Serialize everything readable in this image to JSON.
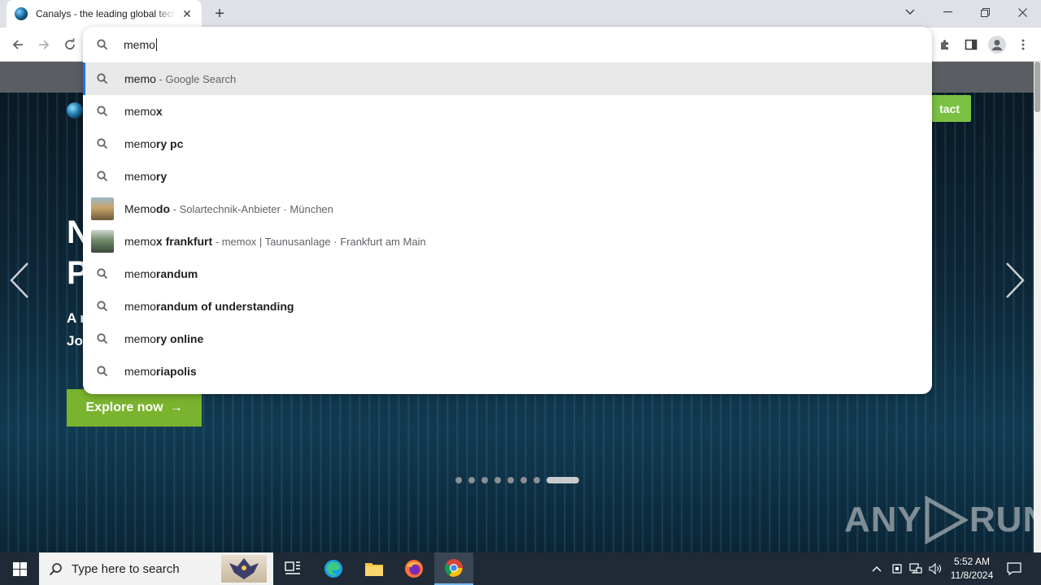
{
  "browser": {
    "tab_title": "Canalys - the leading global technology market analyst firm",
    "tab_close_glyph": "✕",
    "new_tab_glyph": "+",
    "window_controls": {
      "tab_search": "⌄",
      "minimize": "—",
      "restore": "❐",
      "close": "✕"
    }
  },
  "omnibox": {
    "query": "memo",
    "suggestions": [
      {
        "icon": "search-icon",
        "typed": "memo",
        "rest": "",
        "desc": " - Google Search",
        "selected": true
      },
      {
        "icon": "search-icon",
        "typed": "memo",
        "rest": "x",
        "desc": ""
      },
      {
        "icon": "search-icon",
        "typed": "memo",
        "rest": "ry pc",
        "desc": ""
      },
      {
        "icon": "search-icon",
        "typed": "memo",
        "rest": "ry",
        "desc": ""
      },
      {
        "icon": "thumbnail",
        "typed": "Memo",
        "rest": "do",
        "desc": " - Solartechnik-Anbieter · München"
      },
      {
        "icon": "thumbnail",
        "typed": "memo",
        "rest": "x frankfurt",
        "desc": " - memox | Taunusanlage · Frankfurt am Main"
      },
      {
        "icon": "search-icon",
        "typed": "memo",
        "rest": "randum",
        "desc": ""
      },
      {
        "icon": "search-icon",
        "typed": "memo",
        "rest": "randum of understanding",
        "desc": ""
      },
      {
        "icon": "search-icon",
        "typed": "memo",
        "rest": "ry online",
        "desc": ""
      },
      {
        "icon": "search-icon",
        "typed": "memo",
        "rest": "riapolis",
        "desc": ""
      }
    ]
  },
  "page": {
    "contact_label": "tact",
    "hero_line1": "N",
    "hero_line2": "P",
    "hero_sub1": "A r",
    "hero_sub2": "Jo",
    "explore_label": "Explore now",
    "explore_arrow": "→",
    "carousel_dots": 8,
    "carousel_active_index": 7,
    "watermark_left": "ANY",
    "watermark_right": "RUN"
  },
  "taskbar": {
    "search_placeholder": "Type here to search",
    "time": "5:52 AM",
    "date": "11/8/2024"
  },
  "colors": {
    "accent_green": "#7ab32e",
    "omnibox_selected": "#e8e8e9",
    "focus_blue": "#1a73e8",
    "taskbar": "#1f2a36"
  }
}
